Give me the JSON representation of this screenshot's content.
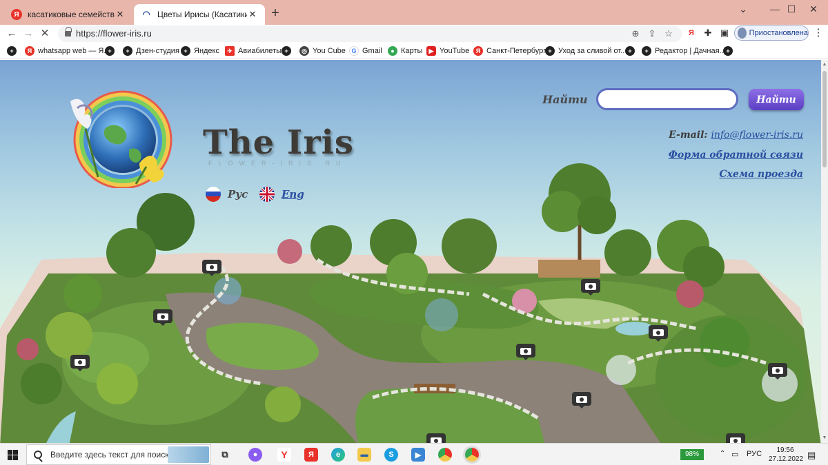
{
  "browser": {
    "tabs": [
      {
        "title": "касатиковые семейство — Янд",
        "favicon": "yandex-icon",
        "active": false
      },
      {
        "title": "Цветы Ирисы (Касатики) - всё о",
        "favicon": "iris-site-icon",
        "active": true
      }
    ],
    "new_tab_label": "+",
    "url": "https://flower-iris.ru",
    "profile_label": "Приостановлена",
    "bookmarks": [
      {
        "label": "",
        "icon": "plus-icon"
      },
      {
        "label": "whatsapp web — Я...",
        "icon": "yandex-icon"
      },
      {
        "label": "",
        "icon": "plus-icon"
      },
      {
        "label": "Дзен-студия",
        "icon": "plus-icon"
      },
      {
        "label": "Яндекс",
        "icon": "plus-icon"
      },
      {
        "label": "Авиабилеты",
        "icon": "avia-icon"
      },
      {
        "label": "",
        "icon": "plus-icon"
      },
      {
        "label": "You Cube",
        "icon": "web-icon"
      },
      {
        "label": "Gmail",
        "icon": "google-icon"
      },
      {
        "label": "Карты",
        "icon": "maps-icon"
      },
      {
        "label": "YouTube",
        "icon": "youtube-icon"
      },
      {
        "label": "Санкт-Петербург",
        "icon": "yandex-icon"
      },
      {
        "label": "Уход за сливой от...",
        "icon": "plus-icon"
      },
      {
        "label": "",
        "icon": "plus-icon"
      },
      {
        "label": "Редактор | Дачная...",
        "icon": "plus-icon"
      },
      {
        "label": "",
        "icon": "plus-icon"
      }
    ]
  },
  "site": {
    "brand": "The Iris",
    "subbrand": "FLOWER-IRIS.RU",
    "lang_ru": "Рус",
    "lang_en": "Eng",
    "search_label": "Найти",
    "search_value": "",
    "search_button": "Найти",
    "email_label": "E-mail:",
    "email": "info@flower-iris.ru",
    "feedback_link": "Форма обратной связи",
    "route_link": "Схема проезда"
  },
  "taskbar": {
    "search_placeholder": "Введите здесь текст для поиска",
    "battery": "98%",
    "lang": "РУС",
    "time": "19:56",
    "date": "27.12.2022"
  },
  "colors": {
    "tab_strip": "#e9b6ac",
    "link": "#2a4fa0",
    "search_button": "#6a4fd4",
    "sky_top": "#7aa3d4"
  }
}
